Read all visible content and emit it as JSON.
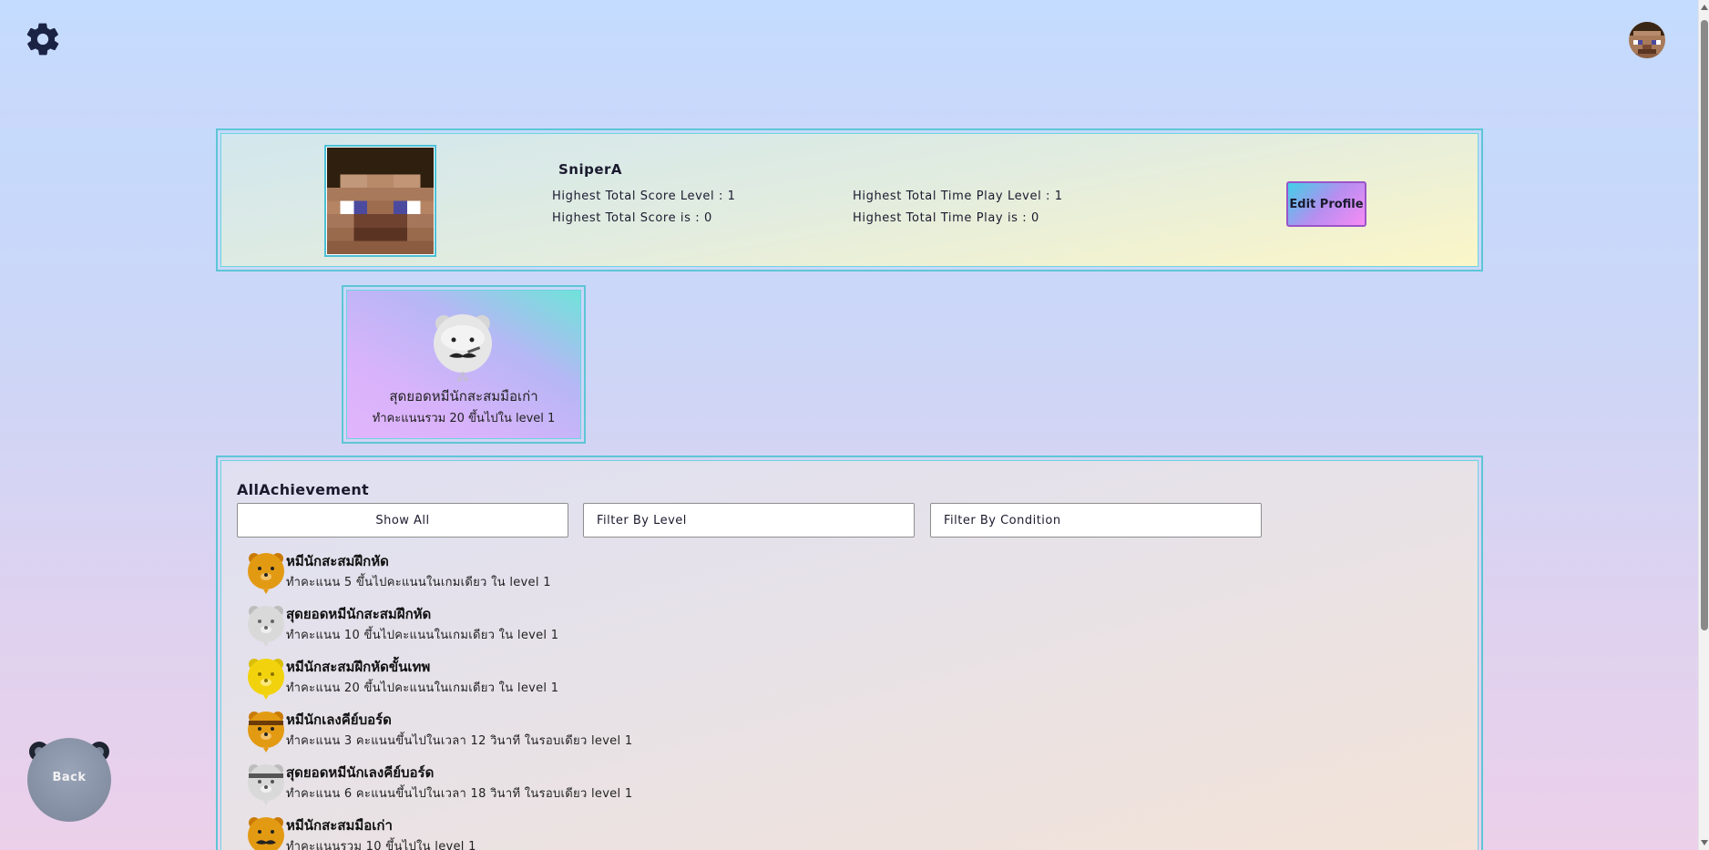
{
  "header": {
    "settings_icon": "gear-icon",
    "avatar_icon": "pixel-steve-avatar"
  },
  "profile": {
    "username": "SniperA",
    "highest_score_level": "Highest Total Score Level : 1",
    "highest_score": "Highest Total Score is : 0",
    "highest_time_level": "Highest Total Time Play Level : 1",
    "highest_time": "Highest Total Time Play is : 0",
    "edit_label": "Edit Profile"
  },
  "featured_badge": {
    "title": "สุดยอดหมีนักสะสมมือเก่า",
    "description": "ทำคะแนนรวม 20 ขึ้นไปใน level 1",
    "icon": "silver-bear-mustache-icon"
  },
  "achievements": {
    "heading": "AllAchievement",
    "filters": {
      "show_all": "Show All",
      "by_level": "Filter By Level",
      "by_condition": "Filter By Condition"
    },
    "items": [
      {
        "title": "หมีนักสะสมฝึกหัด",
        "desc": "ทำคะแนน 5 ขึ้นไปคะแนนในเกมเดียว ใน level 1",
        "icon": "bronze-bear-icon"
      },
      {
        "title": "สุดยอดหมีนักสะสมฝึกหัด",
        "desc": "ทำคะแนน 10 ขึ้นไปคะแนนในเกมเดียว ใน level 1",
        "icon": "silver-bear-icon"
      },
      {
        "title": "หมีนักสะสมฝึกหัดขั้นเทพ",
        "desc": "ทำคะแนน 20 ขึ้นไปคะแนนในเกมเดียว ใน level 1",
        "icon": "gold-bear-icon"
      },
      {
        "title": "หมีนักเลงคีย์บอร์ด",
        "desc": "ทำคะแนน 3 คะแนนขึ้นไปในเวลา 12 วินาที ในรอบเดียว level 1",
        "icon": "bronze-bear-headband-icon"
      },
      {
        "title": "สุดยอดหมีนักเลงคีย์บอร์ด",
        "desc": "ทำคะแนน 6 คะแนนขึ้นไปในเวลา 18 วินาที ในรอบเดียว level 1",
        "icon": "silver-bear-headband-icon"
      },
      {
        "title": "หมีนักสะสมมือเก่า",
        "desc": "ทำคะแนนรวม 10 ขึ้นไปใน level 1",
        "icon": "bronze-bear-mustache-icon"
      }
    ]
  },
  "back": {
    "label": "Back"
  },
  "colors": {
    "accent_border": "#5ec6d6",
    "bronze": "#d98c0b",
    "silver": "#c9c9c9",
    "gold": "#f2d20c"
  }
}
